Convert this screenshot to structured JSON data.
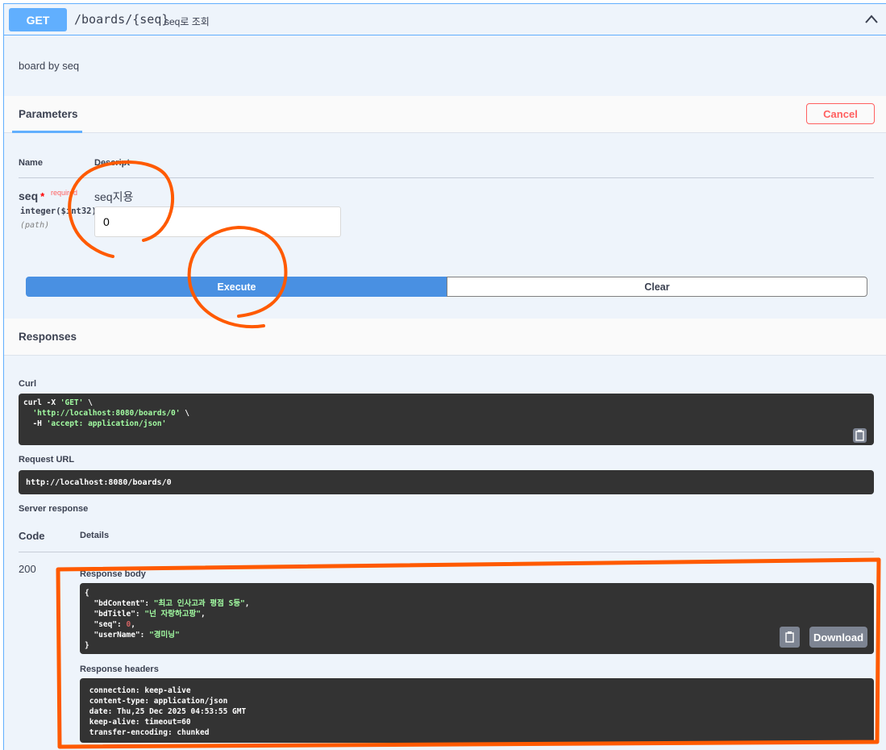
{
  "operation": {
    "method": "GET",
    "path": "/boards/{seq}",
    "summary": "seq로 조회",
    "description": "board by seq"
  },
  "parameters": {
    "title": "Parameters",
    "cancel_label": "Cancel",
    "col_name": "Name",
    "col_description": "Descript",
    "items": [
      {
        "name": "seq",
        "required_mark": "*",
        "required_label": "required",
        "type": "integer($int32)",
        "in": "(path)",
        "description": "seq지용",
        "value": "0"
      }
    ]
  },
  "actions": {
    "execute_label": "Execute",
    "clear_label": "Clear"
  },
  "responses": {
    "title": "Responses",
    "curl_label": "Curl",
    "curl_lines": [
      [
        "curl -X ",
        "'GET'",
        " \\"
      ],
      [
        "  ",
        "'http://localhost:8080/boards/0'",
        " \\"
      ],
      [
        "  -H ",
        "'accept: application/json'",
        ""
      ]
    ],
    "request_url_label": "Request URL",
    "request_url": "http://localhost:8080/boards/0",
    "server_response_label": "Server response",
    "col_code": "Code",
    "col_details": "Details",
    "status_code": "200",
    "body_label": "Response body",
    "body_lines": [
      [
        "{",
        "",
        ""
      ],
      [
        "  \"bdContent\": ",
        "\"최고 인사고과 평점 S등\"",
        ","
      ],
      [
        "  \"bdTitle\": ",
        "\"넌 자랑하고팡\"",
        ","
      ],
      [
        "  \"seq\": ",
        "0",
        ","
      ],
      [
        "  \"userName\": ",
        "\"경미닝\"",
        ""
      ],
      [
        "}",
        "",
        ""
      ]
    ],
    "download_label": "Download",
    "headers_label": "Response headers",
    "header_lines": [
      " connection: keep-alive ",
      " content-type: application/json ",
      " date: Thu,25 Dec 2025 04:53:55 GMT ",
      " keep-alive: timeout=60 ",
      " transfer-encoding: chunked "
    ]
  },
  "colors": {
    "method_get": "#61affe",
    "execute": "#4990e2",
    "cancel": "#ff6060",
    "annotation": "#ff5a00"
  }
}
